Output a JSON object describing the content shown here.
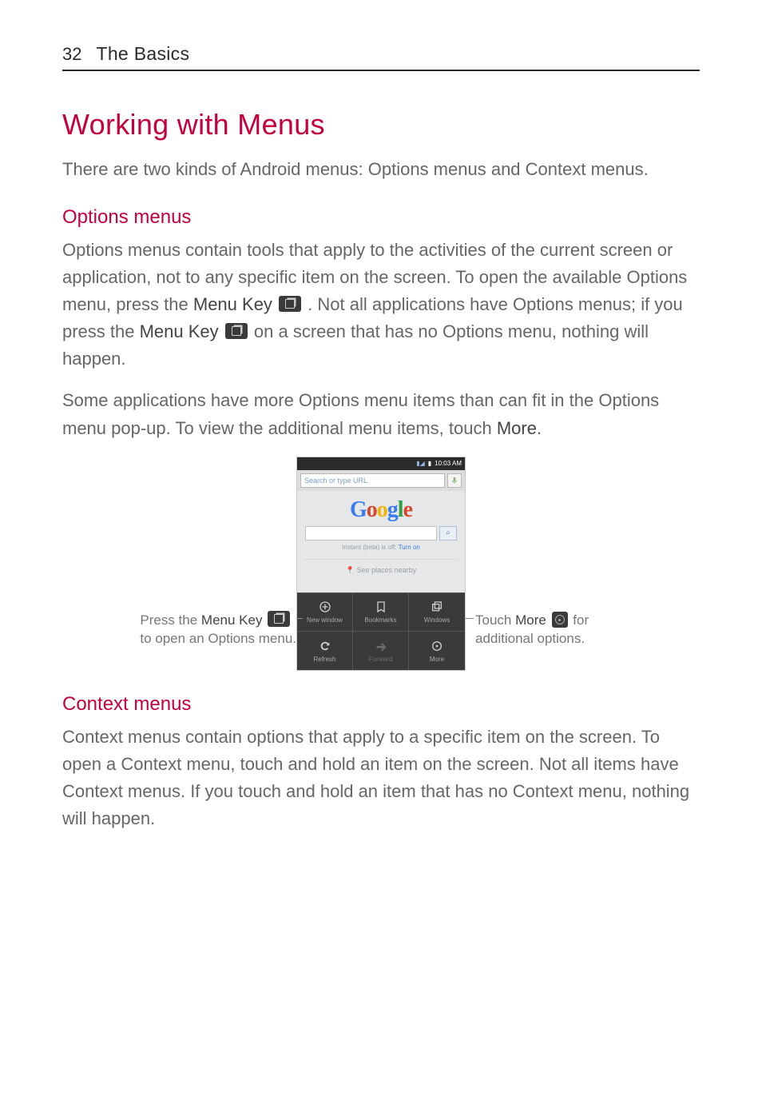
{
  "header": {
    "page_number": "32",
    "section": "The Basics"
  },
  "title": "Working with Menus",
  "intro": "There are two kinds of Android menus: Options menus and Context menus.",
  "options": {
    "heading": "Options menus",
    "p1a": "Options menus contain tools that apply to the activities of the current screen or application, not to any specific item on the screen. To open the available Options menu, press the ",
    "menu_key1": "Menu Key",
    "p1b": ". Not all applications have Options menus; if you press the ",
    "menu_key2": "Menu Key",
    "p1c": " on a screen that has no Options menu, nothing will happen.",
    "p2a": "Some applications have more Options menu items than can fit in the Options menu pop-up. To view the additional menu items, touch ",
    "more": "More",
    "p2b": "."
  },
  "figure": {
    "left_a": "Press the ",
    "left_b": "Menu Key",
    "left_c": "to open an Options menu.",
    "right_a": "Touch ",
    "right_b": "More",
    "right_c": " for",
    "right_d": "additional options."
  },
  "phone": {
    "time": "10:03 AM",
    "url_placeholder": "Search or type URL",
    "logo": "Google",
    "search_icon": "⌕",
    "instant_a": "Instant (beta) is off: ",
    "instant_b": "Turn on",
    "places": "See places nearby",
    "options": [
      {
        "label": "New window"
      },
      {
        "label": "Bookmarks"
      },
      {
        "label": "Windows"
      },
      {
        "label": "Refresh"
      },
      {
        "label": "Forward"
      },
      {
        "label": "More"
      }
    ]
  },
  "context": {
    "heading": "Context menus",
    "body": "Context menus contain options that apply to a specific item on the screen. To open a Context menu, touch and hold an item on the screen. Not all items have Context menus. If you touch and hold an item that has no Context menu, nothing will happen."
  }
}
